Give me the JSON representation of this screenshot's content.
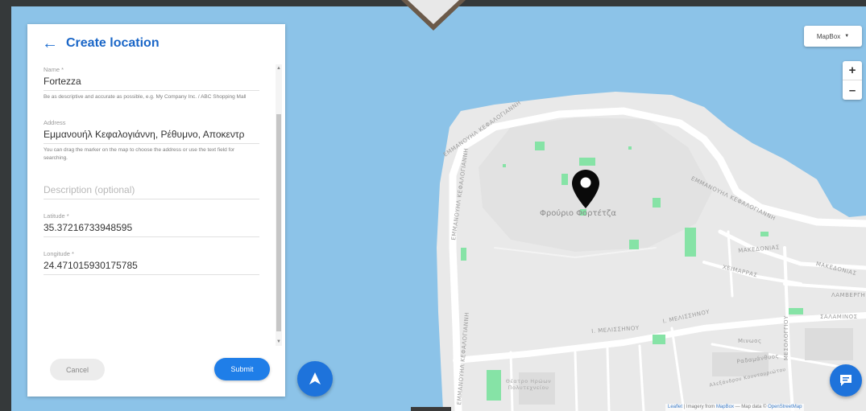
{
  "panel": {
    "title": "Create location",
    "fields": {
      "name": {
        "label": "Name *",
        "value": "Fortezza",
        "help": "Be as descriptive and accurate as possible, e.g. My Company Inc. / ABC Shopping Mall"
      },
      "address": {
        "label": "Address",
        "value": "Εμμανουήλ Κεφαλογιάννη, Ρέθυμνο, Αποκεντρ",
        "help": "You can drag the marker on the map to choose the address or use the text field for searching."
      },
      "description": {
        "placeholder": "Description (optional)"
      },
      "latitude": {
        "label": "Latitude *",
        "value": "35.37216733948595"
      },
      "longitude": {
        "label": "Longitude *",
        "value": "24.471015930175785"
      }
    },
    "cancel_label": "Cancel",
    "submit_label": "Submit"
  },
  "map": {
    "layer_select": "MapBox",
    "poi_label": "Φρούριο Φορτέτζα",
    "streets": [
      "ΕΜΜΑΝΟΥΗΛ ΚΕΦΑΛΟΓΙΑΝΝΗ",
      "ΕΜΜΑΝΟΥΗΛ ΚΕΦΑΛΟΓΙΑΝΝΗ",
      "ΕΜΜΑΝΟΥΗΛ ΚΕΦΑΛΟΓΙΑΝΝΗ",
      "ΕΜΜΑΝΟΥΗΛ ΚΕΦΑΛΟΓΙΑΝΝΗ",
      "ΜΑΚΕΔΟΝΙΑΣ",
      "ΜΑΚΕΔΟΝΙΑΣ",
      "ΧΕΙΜΑΡΡΑΣ",
      "ΛΑΜΒΕΡΓΗ",
      "Ι. ΜΕΛΙΣΣΗΝΟΥ",
      "Ι. ΜΕΛΙΣΣΗΝΟΥ",
      "ΣΑΛΑΜΙΝΟΣ",
      "ΜΕΣΟΛΟΓΓΙΟΥ"
    ],
    "small_labels": [
      "Θέατρο Ηρώων Πολυτεχνείου",
      "Μινωος",
      "Ραδαμάνθυος",
      "Αλεξάνδρου Κουντουριώτου"
    ],
    "attribution": {
      "leaflet": "Leaflet",
      "imagery": "| Imagery from",
      "mapbox": "MapBox",
      "data": "— Map data ©",
      "osm": "OpenStreetMap"
    }
  },
  "icons": {
    "back": "arrow-left-icon",
    "pin": "map-marker-icon",
    "locate": "navigation-arrow-icon",
    "chat": "chat-bubble-icon",
    "dropdown": "caret-down-icon"
  },
  "colors": {
    "accent": "#1f7ee8",
    "title": "#1a66c7",
    "water": "#8cc3e8",
    "land": "#ebebeb",
    "roads": "#ffffff",
    "parks": "#7fe0a0"
  }
}
